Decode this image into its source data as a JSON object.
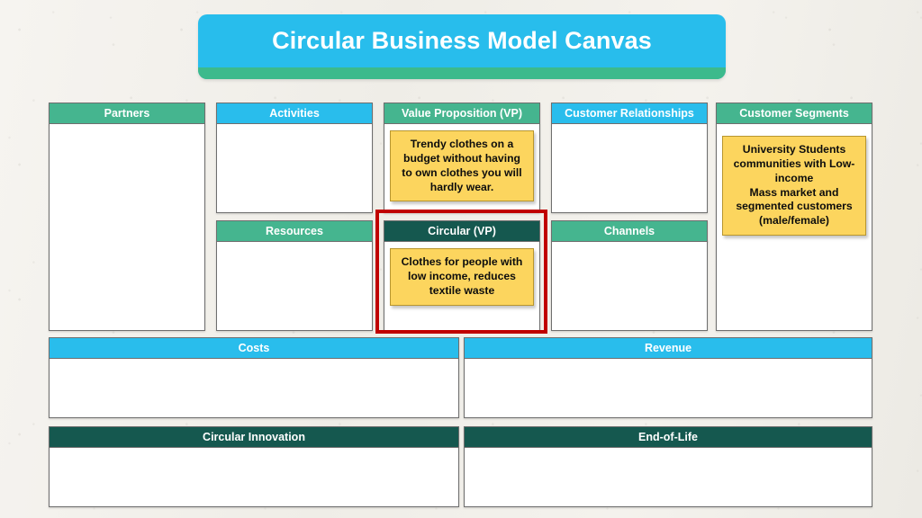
{
  "title": {
    "text": "Circular Business Model Canvas",
    "banner_color": "#28bdec",
    "strip_color": "#3cba8c"
  },
  "palette": {
    "green": "#45b58f",
    "cyan": "#29bdec",
    "teal": "#15584f",
    "note_yellow": "#fcd55e",
    "highlight_red": "#c00000",
    "paper": "#f3f1ec"
  },
  "blocks": {
    "partners": {
      "header": "Partners",
      "header_color": "green",
      "note": null
    },
    "activities": {
      "header": "Activities",
      "header_color": "cyan",
      "note": null
    },
    "resources": {
      "header": "Resources",
      "header_color": "green",
      "note": null
    },
    "value_proposition": {
      "header": "Value Proposition (VP)",
      "header_color": "green",
      "note": [
        "Trendy clothes on a",
        "budget without having",
        "to own clothes you will",
        "hardly wear."
      ]
    },
    "circular_vp": {
      "header": "Circular (VP)",
      "header_color": "teal",
      "highlighted": true,
      "note": [
        "Clothes for people with",
        "low income, reduces",
        "textile waste"
      ]
    },
    "customer_relationships": {
      "header": "Customer Relationships",
      "header_color": "cyan",
      "note": null
    },
    "channels": {
      "header": "Channels",
      "header_color": "green",
      "note": null
    },
    "customer_segments": {
      "header": "Customer Segments",
      "header_color": "green",
      "note": [
        "University Students",
        "communities with Low-",
        "income",
        "Mass market and",
        "segmented customers",
        "(male/female)"
      ]
    },
    "costs": {
      "header": "Costs",
      "header_color": "cyan",
      "note": null
    },
    "revenue": {
      "header": "Revenue",
      "header_color": "cyan",
      "note": null
    },
    "circular_innovation": {
      "header": "Circular Innovation",
      "header_color": "teal",
      "note": null
    },
    "end_of_life": {
      "header": "End-of-Life",
      "header_color": "teal",
      "note": null
    }
  }
}
